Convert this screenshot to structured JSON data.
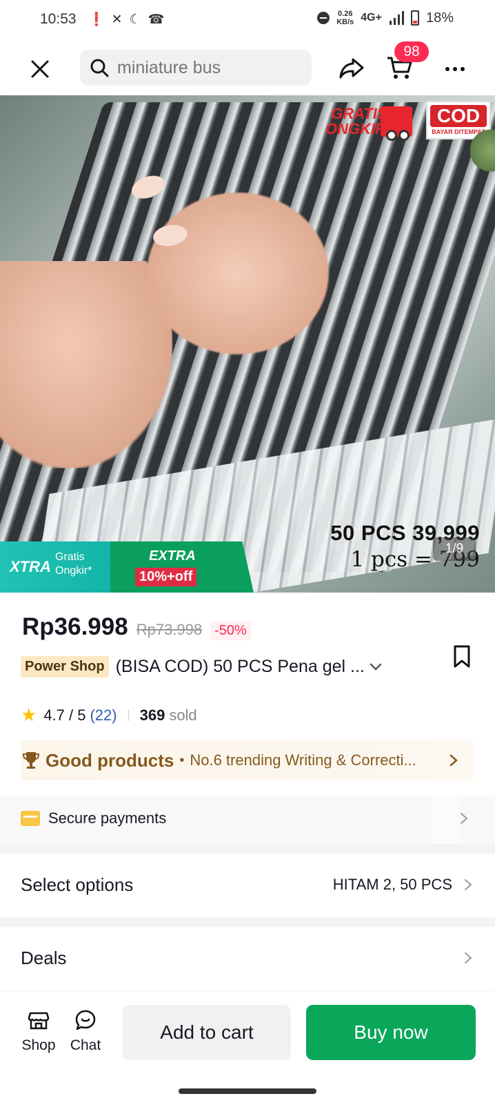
{
  "status_bar": {
    "time": "10:53",
    "net_speed_value": "0.26",
    "net_speed_unit": "KB/s",
    "network_type": "4G+",
    "battery_percent": "18%"
  },
  "nav": {
    "search_placeholder": "miniature bus",
    "cart_count": "98"
  },
  "image": {
    "badge_gratis_line1": "GRATIS",
    "badge_gratis_line2": "ONGKIR",
    "badge_cod": "COD",
    "badge_cod_sub": "BAYAR DITEMPAT",
    "promo_xtra": "XTRA",
    "promo_gratis_line1": "Gratis",
    "promo_gratis_line2": "Ongkir*",
    "promo_extra": "EXTRA",
    "promo_off": "10%+off",
    "caption_line1": "50 PCS 39,999",
    "caption_line2": "1 pcs = 799",
    "counter": "1/9"
  },
  "product": {
    "price_current": "Rp36.998",
    "price_original": "Rp73.998",
    "discount": "-50%",
    "shop_tag": "Power Shop",
    "title": "(BISA COD) 50 PCS Pena gel ...",
    "rating": "4.7 / 5",
    "review_count": "(22)",
    "sold_count": "369",
    "sold_label": "sold",
    "good_products_label": "Good products",
    "trending_text": "No.6 trending Writing & Correcti..."
  },
  "sections": {
    "secure_payments": "Secure payments",
    "select_options_label": "Select options",
    "select_options_value": "HITAM 2, 50 PCS",
    "deals_label": "Deals"
  },
  "bottom_bar": {
    "shop_label": "Shop",
    "chat_label": "Chat",
    "add_to_cart": "Add to cart",
    "buy_now": "Buy now"
  },
  "colors": {
    "accent_red": "#fe2c55",
    "buy_green": "#0aa75b",
    "good_products_brown": "#86581f",
    "rating_star": "#fcc400"
  }
}
